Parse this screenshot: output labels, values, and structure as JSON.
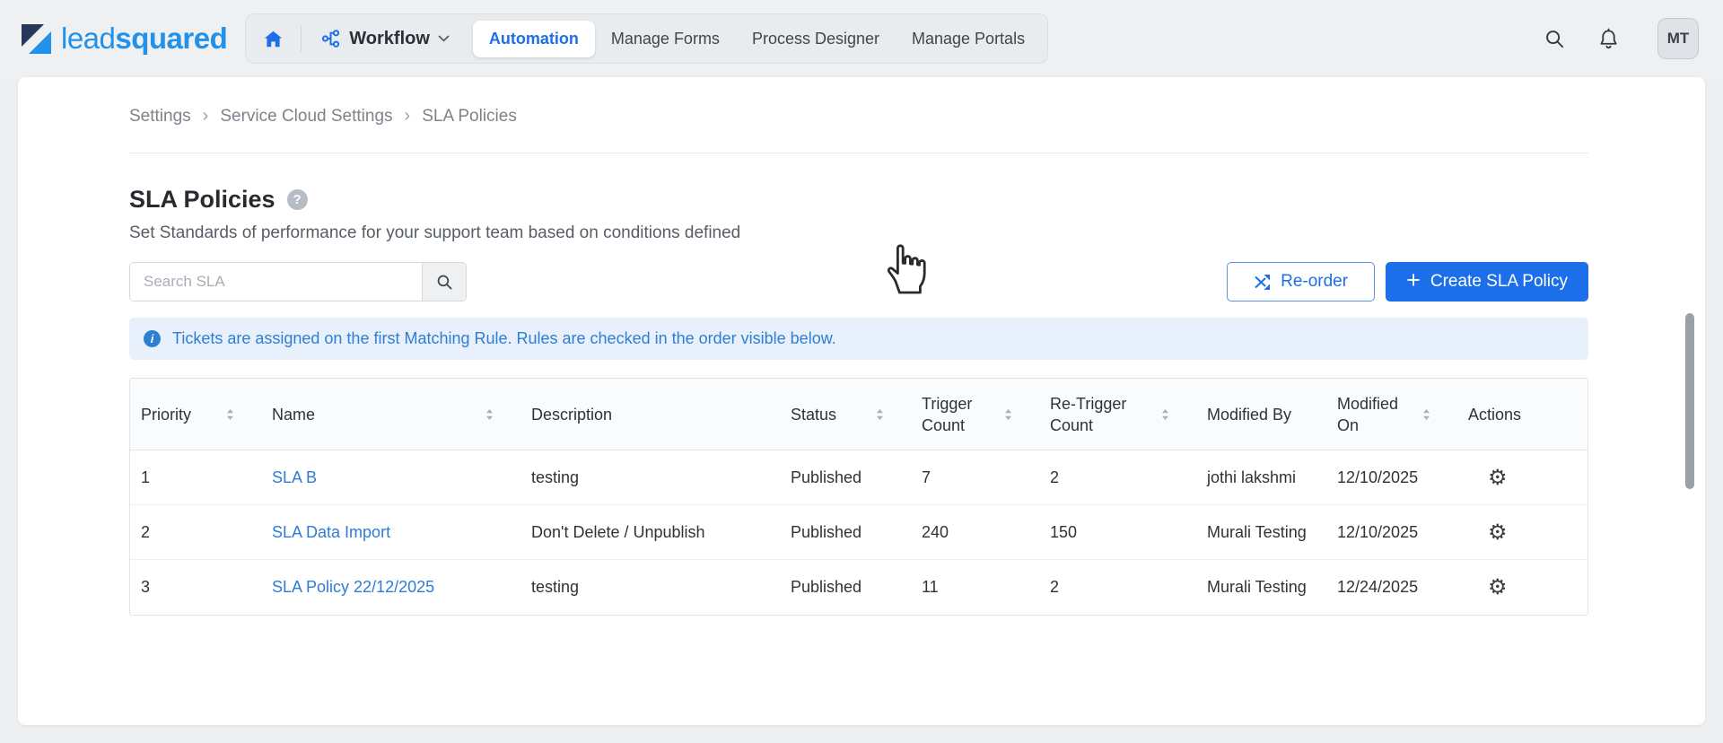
{
  "topbar": {
    "logo_lead": "lead",
    "logo_squared": "squared",
    "workflow_label": "Workflow",
    "tabs": [
      {
        "label": "Automation",
        "active": true
      },
      {
        "label": "Manage Forms",
        "active": false
      },
      {
        "label": "Process Designer",
        "active": false
      },
      {
        "label": "Manage Portals",
        "active": false
      }
    ],
    "avatar_initials": "MT"
  },
  "breadcrumb": [
    "Settings",
    "Service Cloud Settings",
    "SLA Policies"
  ],
  "page": {
    "title": "SLA Policies",
    "subtitle": "Set Standards of performance for your support team based on conditions defined",
    "search_placeholder": "Search SLA",
    "reorder_button": "Re-order",
    "create_button": "Create SLA Policy",
    "info_banner": "Tickets are assigned on the first Matching Rule. Rules are checked in the order visible below."
  },
  "icons": {
    "breadcrumb_separator": "›",
    "gear": "⚙",
    "plus": "+",
    "help": "?",
    "info": "i"
  },
  "table": {
    "headers": [
      {
        "label": "Priority",
        "sortable": true
      },
      {
        "label": "Name",
        "sortable": true
      },
      {
        "label": "Description",
        "sortable": false
      },
      {
        "label": "Status",
        "sortable": true
      },
      {
        "label": "Trigger Count",
        "sortable": true
      },
      {
        "label": "Re-Trigger Count",
        "sortable": true
      },
      {
        "label": "Modified By",
        "sortable": false
      },
      {
        "label": "Modified On",
        "sortable": true
      },
      {
        "label": "Actions",
        "sortable": false
      }
    ],
    "rows": [
      {
        "priority": "1",
        "name": "SLA B",
        "description": "testing",
        "status": "Published",
        "trigger_count": "7",
        "retrigger_count": "2",
        "modified_by": "jothi lakshmi",
        "modified_on": "12/10/2025"
      },
      {
        "priority": "2",
        "name": "SLA Data Import",
        "description": "Don't Delete / Unpublish",
        "status": "Published",
        "trigger_count": "240",
        "retrigger_count": "150",
        "modified_by": "Murali Testing",
        "modified_on": "12/10/2025"
      },
      {
        "priority": "3",
        "name": "SLA Policy 22/12/2025",
        "description": "testing",
        "status": "Published",
        "trigger_count": "11",
        "retrigger_count": "2",
        "modified_by": "Murali Testing",
        "modified_on": "12/24/2025"
      }
    ]
  },
  "colors": {
    "accent_blue": "#1c6fe8",
    "link_blue": "#2e7cd6",
    "banner_text": "#2e7ed3",
    "logo_blue": "#2191e9",
    "logo_navy": "#28365c"
  }
}
